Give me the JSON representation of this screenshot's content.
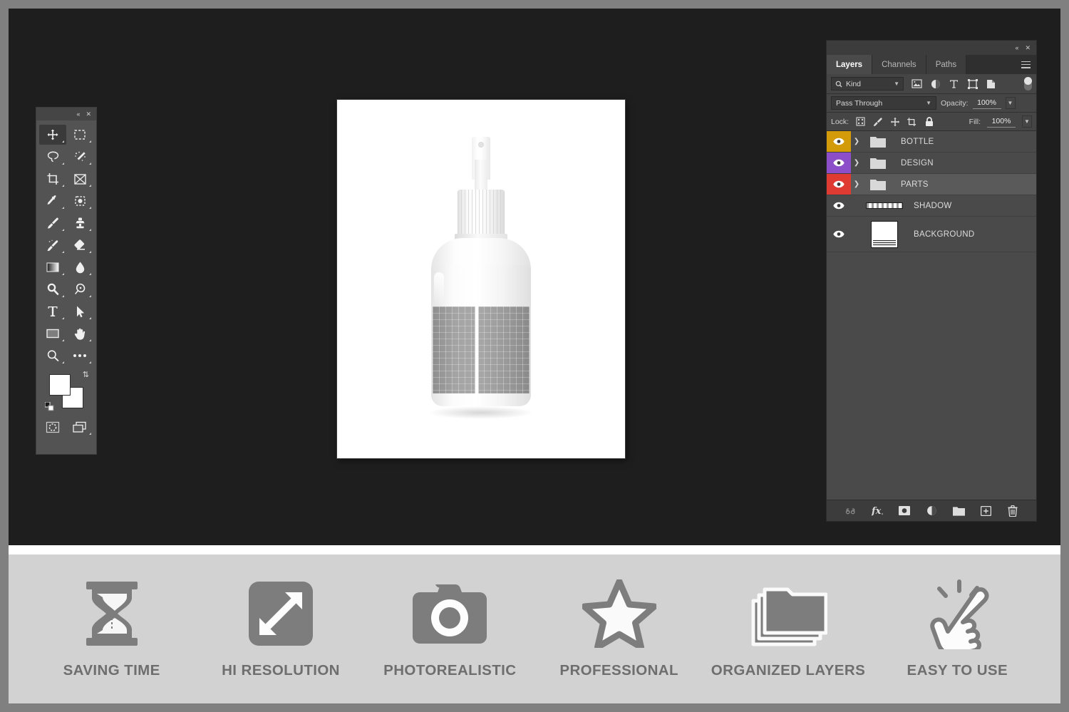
{
  "app": {
    "workspace_bg": "#1e1e1e",
    "frame_color": "#808080"
  },
  "toolbar": {
    "collapse_label": "«",
    "close_label": "✕",
    "tools": [
      {
        "name": "move-tool",
        "selected": true
      },
      {
        "name": "rectangular-marquee-tool",
        "selected": false
      },
      {
        "name": "lasso-tool",
        "selected": false
      },
      {
        "name": "quick-selection-tool",
        "selected": false
      },
      {
        "name": "crop-tool",
        "selected": false
      },
      {
        "name": "frame-tool",
        "selected": false
      },
      {
        "name": "eyedropper-tool",
        "selected": false
      },
      {
        "name": "spot-healing-brush-tool",
        "selected": false
      },
      {
        "name": "brush-tool",
        "selected": false
      },
      {
        "name": "clone-stamp-tool",
        "selected": false
      },
      {
        "name": "history-brush-tool",
        "selected": false
      },
      {
        "name": "eraser-tool",
        "selected": false
      },
      {
        "name": "gradient-tool",
        "selected": false
      },
      {
        "name": "blur-tool",
        "selected": false
      },
      {
        "name": "dodge-tool",
        "selected": false
      },
      {
        "name": "pen-tool",
        "selected": false
      },
      {
        "name": "horizontal-type-tool",
        "selected": false
      },
      {
        "name": "path-selection-tool",
        "selected": false
      },
      {
        "name": "rectangle-tool",
        "selected": false
      },
      {
        "name": "hand-tool",
        "selected": false
      },
      {
        "name": "zoom-tool",
        "selected": false
      },
      {
        "name": "edit-toolbar-tool",
        "selected": false
      }
    ],
    "foreground_color": "#ffffff",
    "background_color": "#ffffff",
    "quick_mask_name": "quick-mask-mode",
    "screen_mode_name": "screen-mode"
  },
  "canvas": {
    "artwork_name": "spray-bottle-mockup"
  },
  "layers_panel": {
    "collapse_label": "«",
    "close_label": "✕",
    "tabs": [
      {
        "label": "Layers",
        "active": true
      },
      {
        "label": "Channels",
        "active": false
      },
      {
        "label": "Paths",
        "active": false
      }
    ],
    "filter": {
      "kind_label": "Kind",
      "icons": [
        "pixel-layer-filter",
        "adjustment-layer-filter",
        "type-layer-filter",
        "shape-layer-filter",
        "smart-object-filter"
      ],
      "toggle_name": "filter-enable-toggle"
    },
    "blend_mode": "Pass Through",
    "opacity_label": "Opacity:",
    "opacity_value": "100%",
    "lock_label": "Lock:",
    "lock_icons": [
      "lock-transparent-pixels",
      "lock-image-pixels",
      "lock-position",
      "lock-artboard-nesting",
      "lock-all"
    ],
    "fill_label": "Fill:",
    "fill_value": "100%",
    "layers": [
      {
        "name": "BOTTLE",
        "color": "#d39b09",
        "type": "group",
        "selected": false,
        "visible": true
      },
      {
        "name": "DESIGN",
        "color": "#8d4fc9",
        "type": "group",
        "selected": false,
        "visible": true
      },
      {
        "name": "PARTS",
        "color": "#e03b32",
        "type": "group",
        "selected": true,
        "visible": true
      },
      {
        "name": "SHADOW",
        "color": "",
        "type": "strip",
        "selected": false,
        "visible": true
      },
      {
        "name": "BACKGROUND",
        "color": "",
        "type": "image",
        "selected": false,
        "visible": true
      }
    ],
    "footer_icons": [
      "link-layers-icon",
      "add-layer-style-icon",
      "add-layer-mask-icon",
      "new-adjustment-layer-icon",
      "new-group-icon",
      "new-layer-icon",
      "delete-layer-icon"
    ]
  },
  "feature_bar": {
    "features": [
      {
        "label": "SAVING TIME",
        "icon": "hourglass-icon"
      },
      {
        "label": "HI RESOLUTION",
        "icon": "resize-arrows-icon"
      },
      {
        "label": "PHOTOREALISTIC",
        "icon": "camera-icon"
      },
      {
        "label": "PROFESSIONAL",
        "icon": "star-icon"
      },
      {
        "label": "ORGANIZED LAYERS",
        "icon": "stacked-folders-icon"
      },
      {
        "label": "EASY TO USE",
        "icon": "tapping-hand-icon"
      }
    ],
    "text_color": "#6e6e6e",
    "background": "#d2d2d2"
  }
}
